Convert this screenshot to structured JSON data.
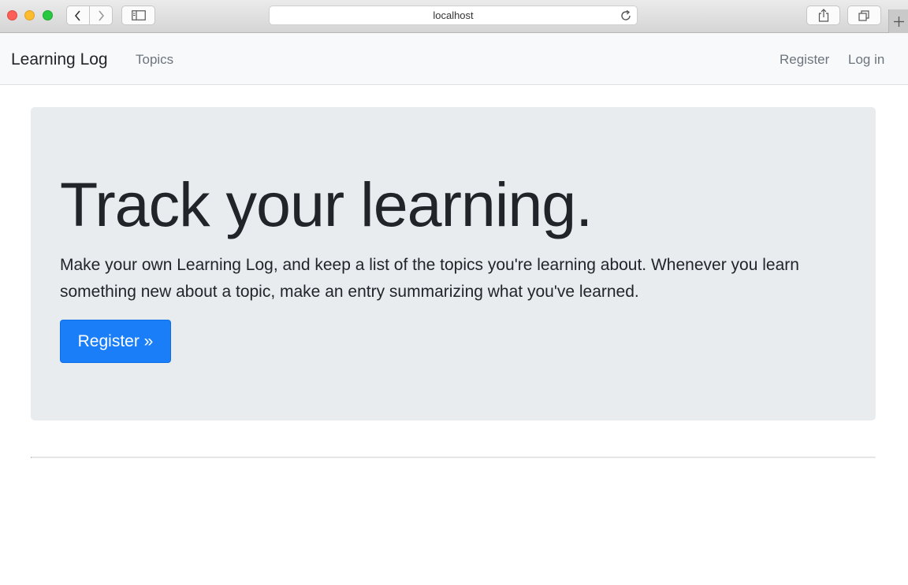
{
  "browser": {
    "url": "localhost"
  },
  "navbar": {
    "brand": "Learning Log",
    "topics": "Topics",
    "register": "Register",
    "login": "Log in"
  },
  "jumbotron": {
    "title": "Track your learning.",
    "lead": "Make your own Learning Log, and keep a list of the topics you're learning about. Whenever you learn something new about a topic, make an entry summarizing what you've learned.",
    "button": "Register »"
  },
  "colors": {
    "primary_button": "#1a7ef8",
    "jumbotron_bg": "#e9ecef",
    "navbar_bg": "#f8f9fa"
  }
}
